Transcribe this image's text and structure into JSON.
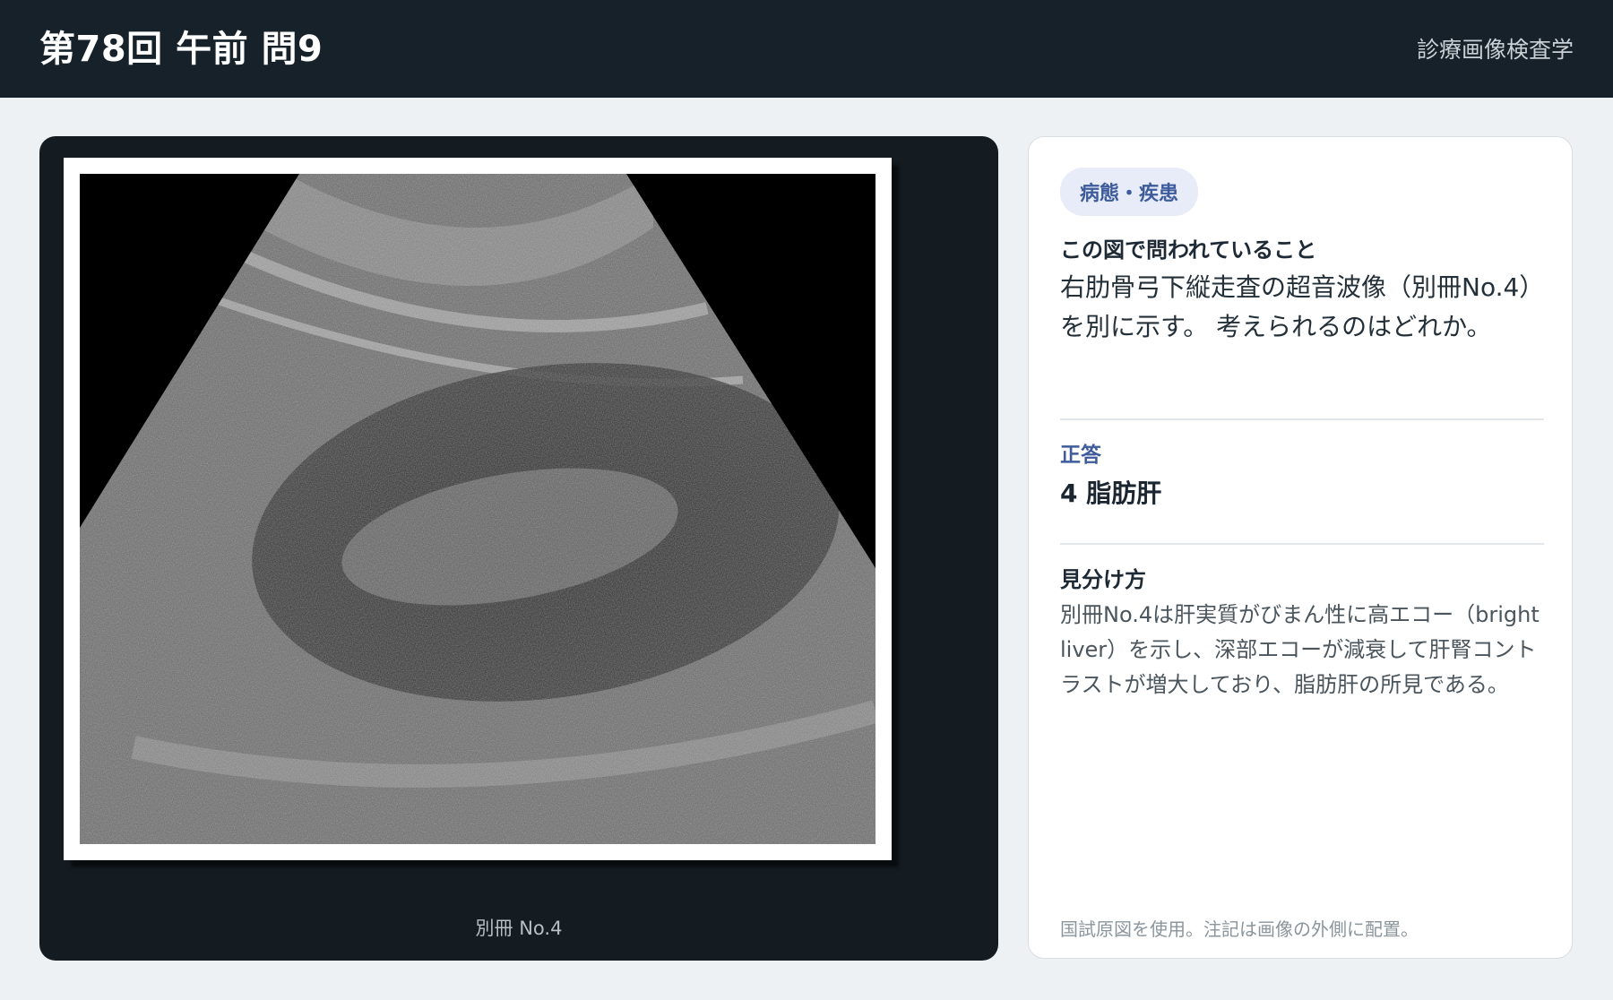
{
  "header": {
    "title": "第78回 午前 問9",
    "subject": "診療画像検査学"
  },
  "figure": {
    "caption": "別冊 No.4",
    "image_description_icon": "ultrasound-image"
  },
  "card": {
    "category_badge": "病態・疾患",
    "question_heading": "この図で問われていること",
    "question_text": "右肋骨弓下縦走査の超音波像（別冊No.4）を別に示す。 考えられるのはどれか。",
    "answer_label": "正答",
    "answer_value": "4 脂肪肝",
    "tips_heading": "見分け方",
    "tips_text": "別冊No.4は肝実質がびまん性に高エコー（bright liver）を示し、深部エコーが減衰して肝腎コントラストが増大しており、脂肪肝の所見である。",
    "footnote": "国試原図を使用。注記は画像の外側に配置。"
  },
  "colors": {
    "header_bg": "#16212a",
    "figure_bg": "#141c22",
    "accent": "#3e5b9c",
    "badge_bg": "#e7ecf8"
  }
}
